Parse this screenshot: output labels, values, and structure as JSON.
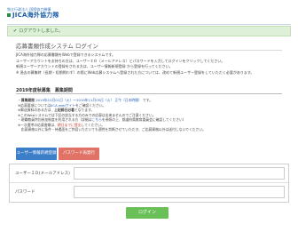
{
  "header": {
    "logo_sub": "独立行政法人 国際協力機構",
    "logo_main": "JICA海外協力隊"
  },
  "alert": {
    "message": "ログアウトしました。",
    "check_glyph": "✔"
  },
  "page": {
    "title": "応募書類作成システム ログイン",
    "intro_lines": [
      "JICA海外協力隊の応募書類をWebで登録できるシステムです。",
      "ユーザーアカウントをお持ちの方は、ユーザーＩＤ（メールアドレス）とパスワードを入力してログインをクリックしてください。",
      "新規ユーザーアカウントの登録をされる方は、ユーザー情報新規登録 から登録を行ってください。",
      "※ 過去の募集時（長期・短期問わず）の際にWeb応募システムへ登録された方については、改めて新規ユーザー登録をしていただく必要があります。"
    ]
  },
  "recruit": {
    "title": "2019年度秋募集　募集期間",
    "period_label": "・募集期間",
    "period_value": "2019年10月01日（火）～2019年11月05日（火） 正午（日本時間）",
    "period_suffix": "です。",
    "note1_prefix": "※応募要項については",
    "note1_link": "JICA webサイト",
    "note1_suffix": "をご確認ください。",
    "note2_prefix": "※郵送資料のある方は、",
    "note2_bold": "上記締日必着",
    "note2_suffix": "となります。",
    "note3": "※このWebシステムでは下記の該当する方のみでの応募は出来ませんのでご注意ください。",
    "note4_prefix": "・現職教員特別参加制度を利用される方（詳細は",
    "note4_link": "こちら",
    "note4_suffix": "を参照の上、都道府県教育委員会に確認してください）",
    "note5_prefix": "※一次選考の応募書類は、",
    "note5_red": "締日までに提出",
    "note5_suffix": "してください。",
    "note6": "　応募資格以外に条件・待遇面をご許容いただいても適性を判断させていただき、ご応募資格以外は送付しないでください。"
  },
  "buttons": {
    "new_user": "ユーザー情報新規登録",
    "password_reset": "パスワード再発行",
    "login": "ログイン"
  },
  "form": {
    "user_id_label": "ユーザーＩＤ(メールアドレス)",
    "user_id_value": "",
    "password_label": "パスワード",
    "password_value": ""
  },
  "colors": {
    "alert_bg": "#dff0d8",
    "primary_blue": "#3d7ec9",
    "danger_red": "#e07266",
    "login_green": "#6bbf59",
    "logo_blue": "#1a5fa8"
  }
}
